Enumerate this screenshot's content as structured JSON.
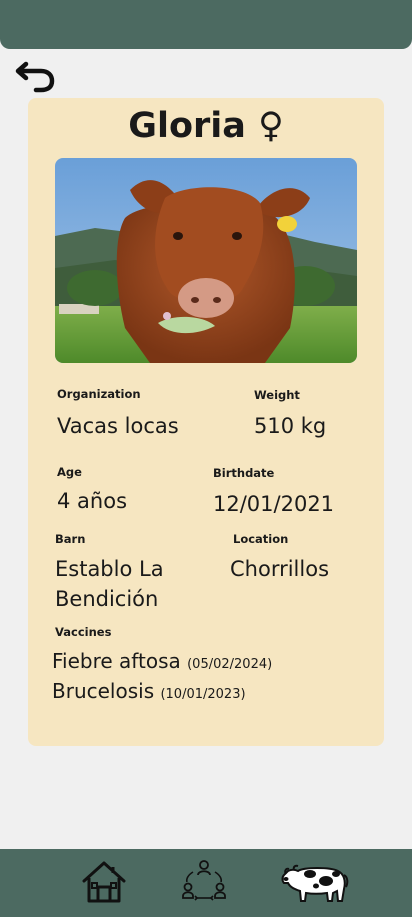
{
  "animal": {
    "name": "Gloria",
    "sex_symbol": "♀"
  },
  "details": {
    "organization": {
      "label": "Organization",
      "value": "Vacas locas"
    },
    "weight": {
      "label": "Weight",
      "value": "510 kg"
    },
    "age": {
      "label": "Age",
      "value": "4 años"
    },
    "birthdate": {
      "label": "Birthdate",
      "value": "12/01/2021"
    },
    "barn": {
      "label": "Barn",
      "value": "Establo La Bendición"
    },
    "location": {
      "label": "Location",
      "value": "Chorrillos"
    }
  },
  "vaccines": {
    "label": "Vaccines",
    "items": [
      {
        "name": "Fiebre aftosa",
        "date": "(05/02/2024)"
      },
      {
        "name": "Brucelosis",
        "date": "(10/01/2023)"
      }
    ]
  },
  "icons": {
    "back": "undo-arrow-icon",
    "home": "home-icon",
    "community": "community-icon",
    "cow": "cow-icon"
  },
  "colors": {
    "bars": "#4c6a61",
    "card": "#f6e6c1",
    "background": "#f0f0f0"
  }
}
